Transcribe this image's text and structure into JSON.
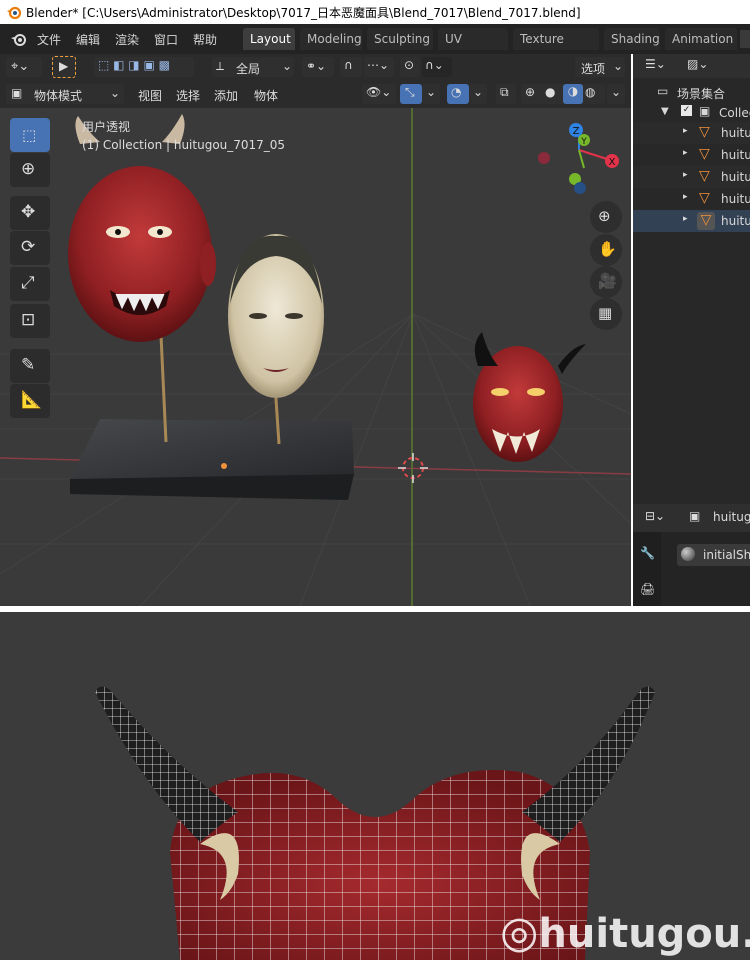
{
  "window": {
    "title": "Blender* [C:\\Users\\Administrator\\Desktop\\7017_日本恶魔面具\\Blend_7017\\Blend_7017.blend]"
  },
  "menu": {
    "items": [
      "文件",
      "编辑",
      "渲染",
      "窗口",
      "帮助"
    ]
  },
  "workspaces": {
    "tabs": [
      "Layout",
      "Modeling",
      "Sculpting",
      "UV Editing",
      "Texture Paint",
      "Shading",
      "Animation"
    ],
    "active": "Layout"
  },
  "viewport": {
    "transform_orientation": "全局",
    "options_label": "选项",
    "mode": "物体模式",
    "header_menus": [
      "视图",
      "选择",
      "添加",
      "物体"
    ],
    "perspective_label": "用户透视",
    "collection_info": "(1) Collection | huitugou_7017_05",
    "gizmo_axes": {
      "x": "X",
      "y": "Y",
      "z": "Z"
    }
  },
  "outliner": {
    "scene_collection": "场景集合",
    "collection": "Collec",
    "items": [
      "huitu",
      "huitu",
      "huitu",
      "huitu",
      "huitu"
    ]
  },
  "properties": {
    "object_name": "huitugo",
    "material_slot": "initialSha"
  },
  "watermark": {
    "text": "huitugou.com"
  },
  "colors": {
    "accent": "#4772b3",
    "viewport_bg": "#3a3a3a",
    "axis_x": "#e2334a",
    "axis_y": "#76b82a",
    "axis_z": "#2f83e3",
    "object_orange": "#f0913c"
  }
}
